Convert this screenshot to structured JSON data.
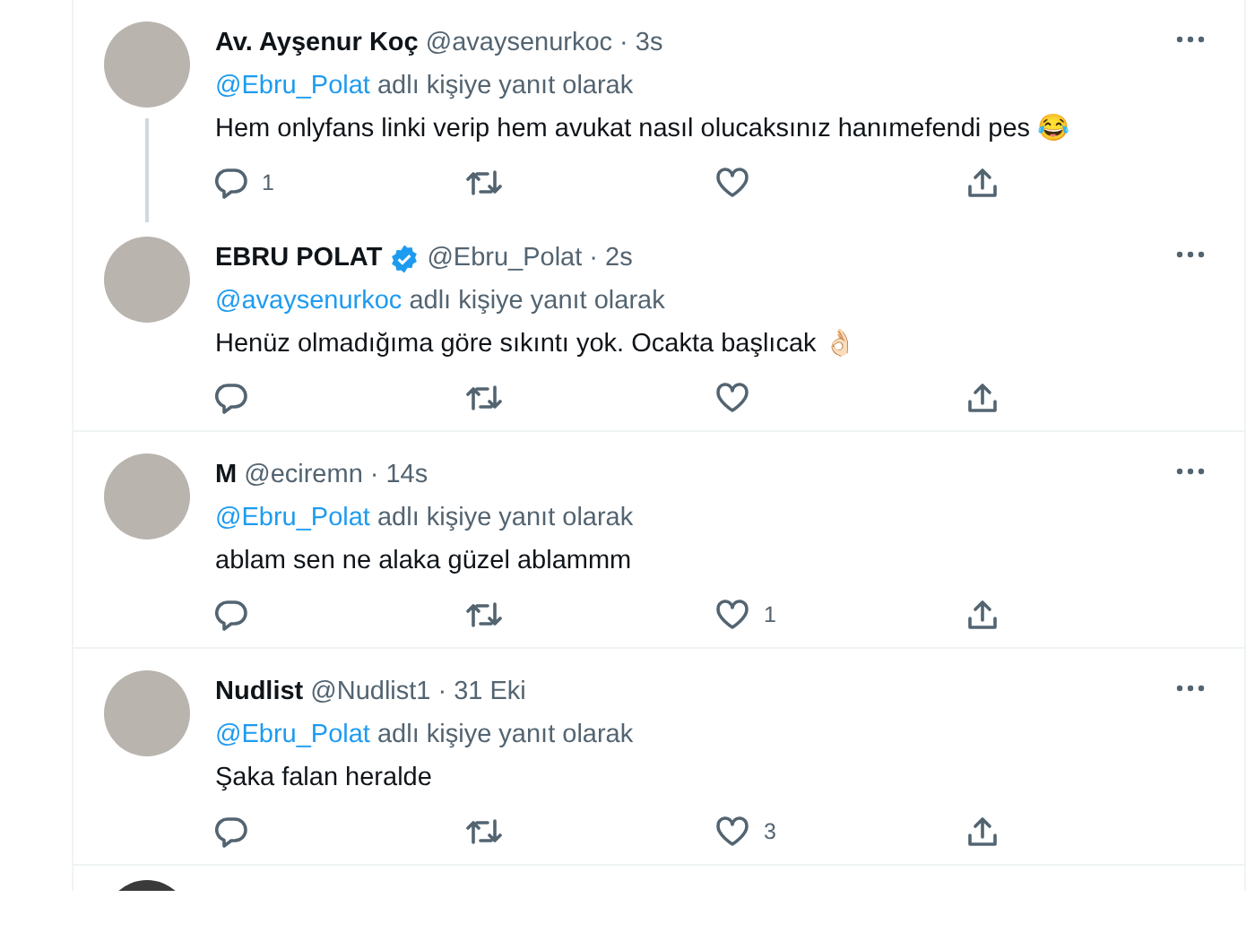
{
  "tweets": [
    {
      "name": "Av. Ayşenur Koç",
      "verified": false,
      "handle": "@avaysenurkoc",
      "separator": "·",
      "time": "3s",
      "reply_to": "@Ebru_Polat",
      "reply_suffix": "adlı kişiye yanıt olarak",
      "text": "Hem onlyfans linki verip hem avukat nasıl olucaksınız hanımefendi pes 😂",
      "thread_continues": true,
      "replies": "1"
    },
    {
      "name": "EBRU POLAT",
      "verified": true,
      "handle": "@Ebru_Polat",
      "separator": "·",
      "time": "2s",
      "reply_to": "@avaysenurkoc",
      "reply_suffix": "adlı kişiye yanıt olarak",
      "text": "Henüz olmadığıma göre sıkıntı yok. Ocakta başlıcak 👌🏻",
      "thread_continues": false
    },
    {
      "name": "M",
      "verified": false,
      "handle": "@eciremn",
      "separator": "·",
      "time": "14s",
      "reply_to": "@Ebru_Polat",
      "reply_suffix": "adlı kişiye yanıt olarak",
      "text": "ablam sen ne alaka güzel ablammm",
      "thread_continues": false,
      "likes": "1"
    },
    {
      "name": "Nudlist",
      "verified": false,
      "handle": "@Nudlist1",
      "separator": "·",
      "time": "31 Eki",
      "reply_to": "@Ebru_Polat",
      "reply_suffix": "adlı kişiye yanıt olarak",
      "text": "Şaka falan heralde",
      "thread_continues": false,
      "likes": "3"
    }
  ]
}
